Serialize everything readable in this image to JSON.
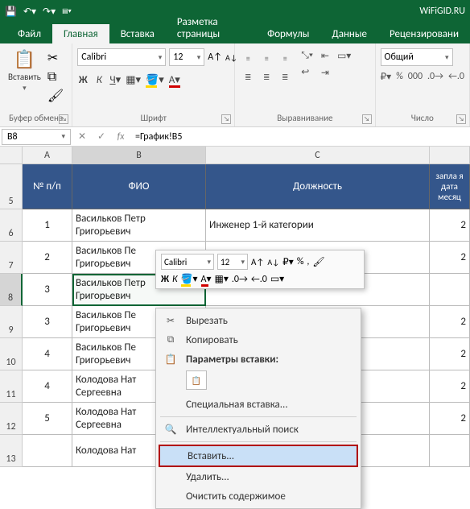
{
  "titlebar": {
    "doc_indicator": "WiFiGID.RU"
  },
  "tabs": {
    "file": "Файл",
    "home": "Главная",
    "insert": "Вставка",
    "layout": "Разметка страницы",
    "formulas": "Формулы",
    "data": "Данные",
    "review": "Рецензировани"
  },
  "ribbon": {
    "clipboard": {
      "label": "Буфер обмена",
      "paste": "Вставить"
    },
    "font": {
      "label": "Шрифт",
      "name": "Calibri",
      "size": "12"
    },
    "alignment": {
      "label": "Выравнивание"
    },
    "number": {
      "label": "Число",
      "format": "Общий"
    }
  },
  "formula_bar": {
    "cell_ref": "B8",
    "formula": "=График!B5"
  },
  "columns": {
    "A": "A",
    "B": "B",
    "C": "C"
  },
  "row_nums": [
    "5",
    "6",
    "7",
    "8",
    "9",
    "10",
    "11",
    "12",
    "13"
  ],
  "headers": {
    "A": "№ п/п",
    "B": "ФИО",
    "C": "Должность",
    "D": "запла\nя дата\nмесяц"
  },
  "rows": [
    {
      "n": "1",
      "fio": "Васильков Петр Григорьевич",
      "pos": "Инженер 1-й категории",
      "d": "2"
    },
    {
      "n": "2",
      "fio": "Васильков Пе\nГригорьевич",
      "pos": "",
      "d": "2"
    },
    {
      "n": "3",
      "fio": "Васильков Петр\nГригорьевич",
      "pos": "",
      "d": ""
    },
    {
      "n": "3",
      "fio": "Васильков Пе\nГригорьевич",
      "pos": "",
      "d": "2"
    },
    {
      "n": "4",
      "fio": "Васильков Пе\nГригорьевич",
      "pos": "",
      "d": "2"
    },
    {
      "n": "4",
      "fio": "Колодова Нат\nСергеевна",
      "pos": "",
      "d": "2"
    },
    {
      "n": "5",
      "fio": "Колодова Нат\nСергеевна",
      "pos": "",
      "d": "2"
    },
    {
      "n": "",
      "fio": "Колодова Нат",
      "pos": "",
      "d": ""
    }
  ],
  "minitoolbar": {
    "font": "Calibri",
    "size": "12"
  },
  "context_menu": {
    "cut": "Вырезать",
    "copy": "Копировать",
    "paste_params": "Параметры вставки:",
    "paste_special": "Специальная вставка...",
    "smart_lookup": "Интеллектуальный поиск",
    "insert": "Вставить...",
    "delete": "Удалить...",
    "clear": "Очистить содержимое"
  }
}
